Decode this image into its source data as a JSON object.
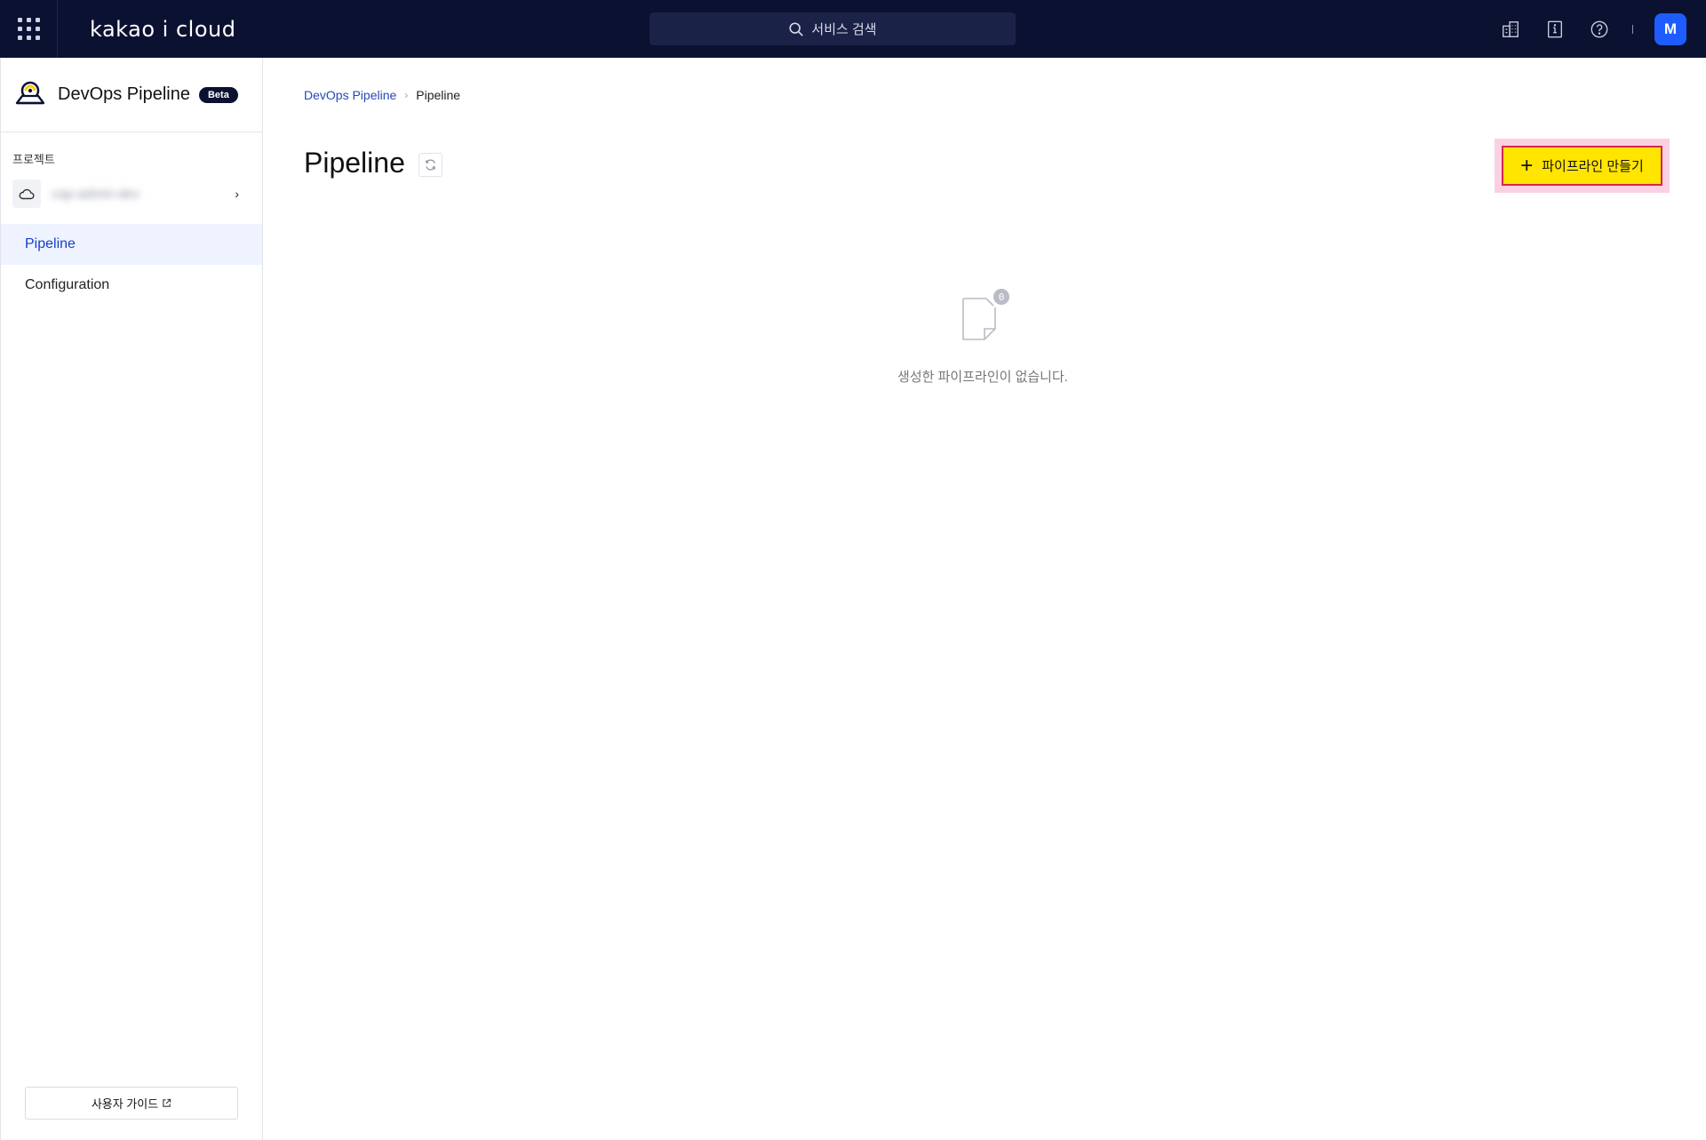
{
  "topbar": {
    "logo": "kakao i cloud",
    "search_placeholder": "서비스 검색",
    "avatar_initial": "M"
  },
  "sidebar": {
    "service_title": "DevOps Pipeline",
    "beta_badge": "Beta",
    "project_label": "프로젝트",
    "project_name": "cap-admin-dev",
    "items": [
      {
        "label": "Pipeline",
        "active": true
      },
      {
        "label": "Configuration",
        "active": false
      }
    ],
    "guide_button": "사용자 가이드"
  },
  "main": {
    "breadcrumb": {
      "parent": "DevOps Pipeline",
      "current": "Pipeline"
    },
    "title": "Pipeline",
    "create_button": "파이프라인 만들기",
    "empty_count": "0",
    "empty_message": "생성한 파이프라인이 없습니다."
  },
  "colors": {
    "topbar_bg": "#0b1130",
    "accent": "#ffe500",
    "link": "#2846b8",
    "avatar": "#1f5cff"
  }
}
